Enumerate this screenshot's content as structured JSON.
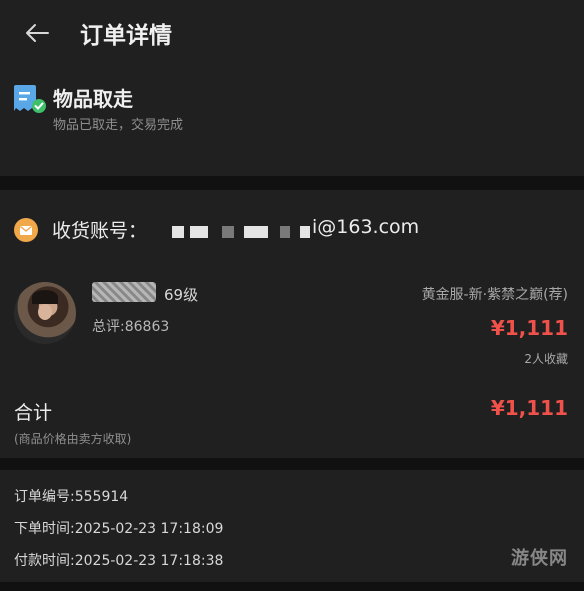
{
  "header": {
    "title": "订单详情",
    "back_icon": "arrow-left-icon"
  },
  "status": {
    "icon": "receipt-check-icon",
    "title": "物品取走",
    "description": "物品已取走，交易完成"
  },
  "order": {
    "account_label": "收货账号：",
    "account_value": "i@163.com",
    "item": {
      "level": "69级",
      "review": "总评:86863",
      "server": "黄金服-新·紫禁之巅(荐)",
      "price": "¥1,111",
      "favorites": "2人收藏"
    },
    "total_label": "合计",
    "total_price": "¥1,111",
    "total_note": "(商品价格由卖方收取)"
  },
  "info": {
    "order_no": "订单编号:555914",
    "order_time": "下单时间:2025-02-23 17:18:09",
    "pay_time": "付款时间:2025-02-23 17:18:38"
  },
  "watermark": "游侠网",
  "colors": {
    "accent_price": "#f0514a",
    "status_icon": "#5aa7e8",
    "mail_icon": "#f0a84a"
  }
}
